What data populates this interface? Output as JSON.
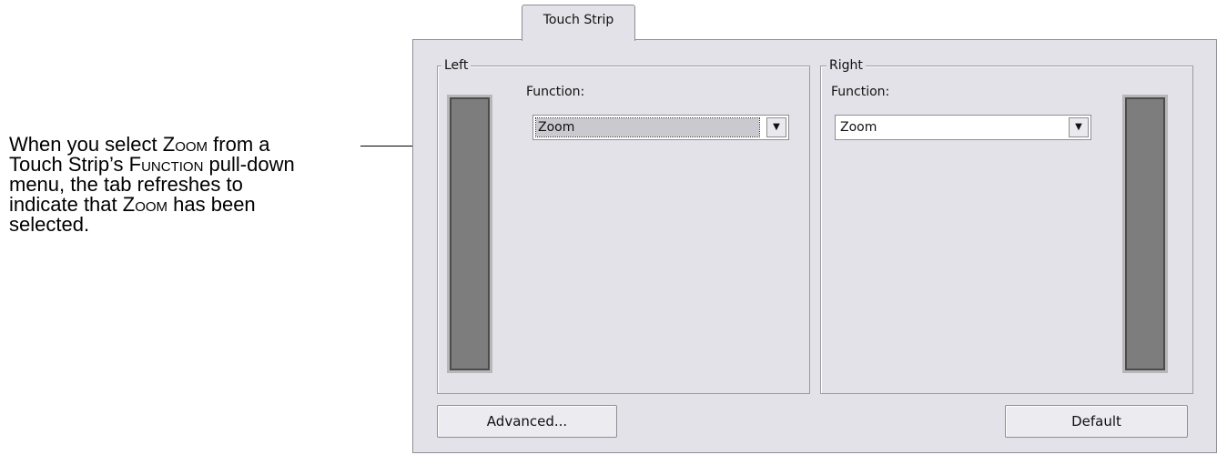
{
  "annotation": {
    "line1_a": "When you select ",
    "line1_sc": "Zoom",
    "line1_b": " from a",
    "line2_a": "Touch Strip’s ",
    "line2_sc": "Function",
    "line2_b": " pull-down",
    "line3": "menu, the tab refreshes to",
    "line4_a": "indicate that ",
    "line4_sc": "Zoom",
    "line4_b": " has been",
    "line5": "selected."
  },
  "dialog": {
    "tab_label": "Touch Strip",
    "left_group": {
      "legend": "Left",
      "function_label": "Function:",
      "function_value": "Zoom"
    },
    "right_group": {
      "legend": "Right",
      "function_label": "Function:",
      "function_value": "Zoom"
    },
    "advanced_button": "Advanced...",
    "default_button": "Default"
  },
  "icons": {
    "dropdown_arrow": "chevron-down-icon"
  },
  "colors": {
    "panel_bg": "#e3e2e8",
    "strip_fill": "#7d7d7d"
  }
}
